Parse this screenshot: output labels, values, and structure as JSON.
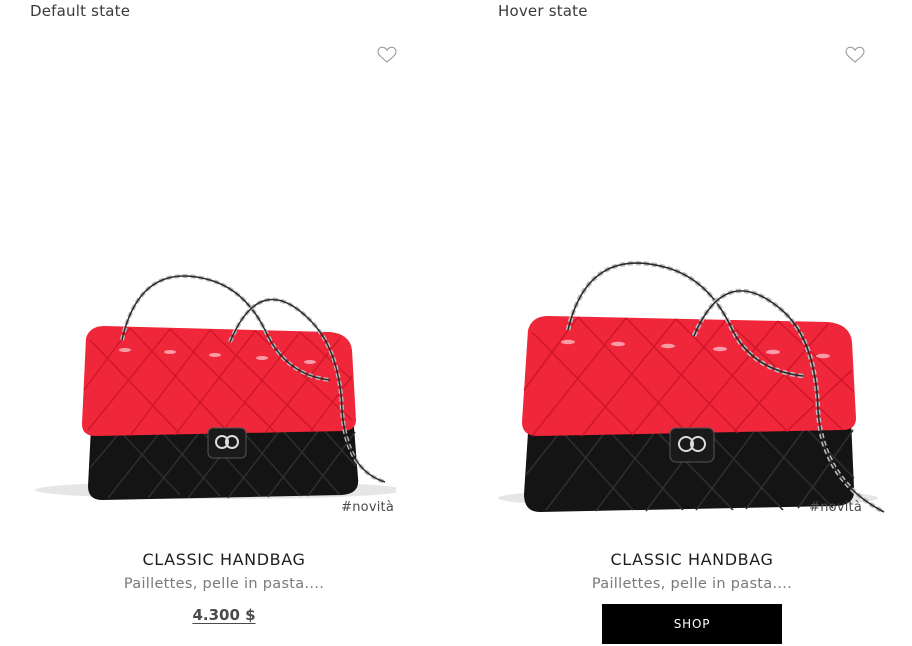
{
  "labels": {
    "default_state": "Default state",
    "hover_state": "Hover state"
  },
  "cards": {
    "default": {
      "tag": "#novità",
      "title": "CLASSIC HANDBAG",
      "subtitle": "Paillettes, pelle in pasta....",
      "price": "4.300 $",
      "favorite_icon": "heart-outline-icon"
    },
    "hover": {
      "tag": "#novità",
      "title": "CLASSIC HANDBAG",
      "subtitle": "Paillettes, pelle in pasta....",
      "button_label": "SHOP",
      "favorite_icon": "heart-outline-icon"
    }
  },
  "colors": {
    "bag_red": "#f0263a",
    "bag_black": "#121212",
    "button_bg": "#000000",
    "button_text": "#ffffff"
  }
}
